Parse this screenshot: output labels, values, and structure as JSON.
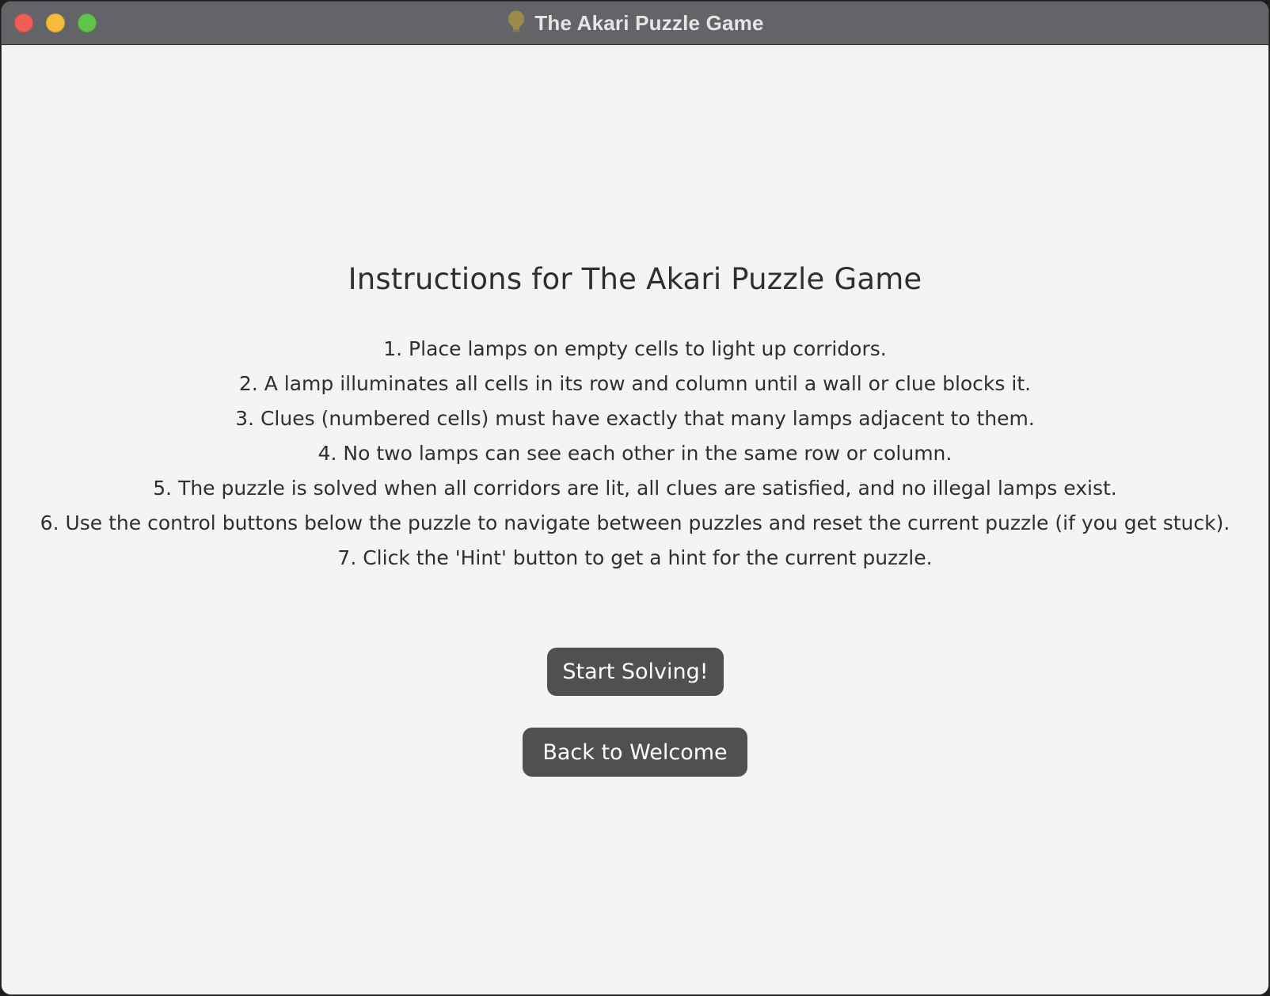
{
  "window": {
    "title": "The Akari Puzzle Game",
    "title_icon": "lightbulb-icon"
  },
  "instructions": {
    "heading": "Instructions for The Akari Puzzle Game",
    "rules": [
      "1. Place lamps on empty cells to light up corridors.",
      "2. A lamp illuminates all cells in its row and column until a wall or clue blocks it.",
      "3. Clues (numbered cells) must have exactly that many lamps adjacent to them.",
      "4. No two lamps can see each other in the same row or column.",
      "5. The puzzle is solved when all corridors are lit, all clues are satisfied, and no illegal lamps exist.",
      "6. Use the control buttons below the puzzle to navigate between puzzles and reset the current puzzle (if you get stuck).",
      "7. Click the 'Hint' button to get a hint for the current puzzle."
    ]
  },
  "buttons": {
    "start_label": "Start Solving!",
    "back_label": "Back to Welcome"
  },
  "colors": {
    "titlebar": "#636467",
    "background": "#f4f4f4",
    "button": "#505050",
    "text": "#2f2f2f",
    "close": "#ee5e57",
    "minimize": "#f5bd3b",
    "maximize": "#5fc44a"
  }
}
